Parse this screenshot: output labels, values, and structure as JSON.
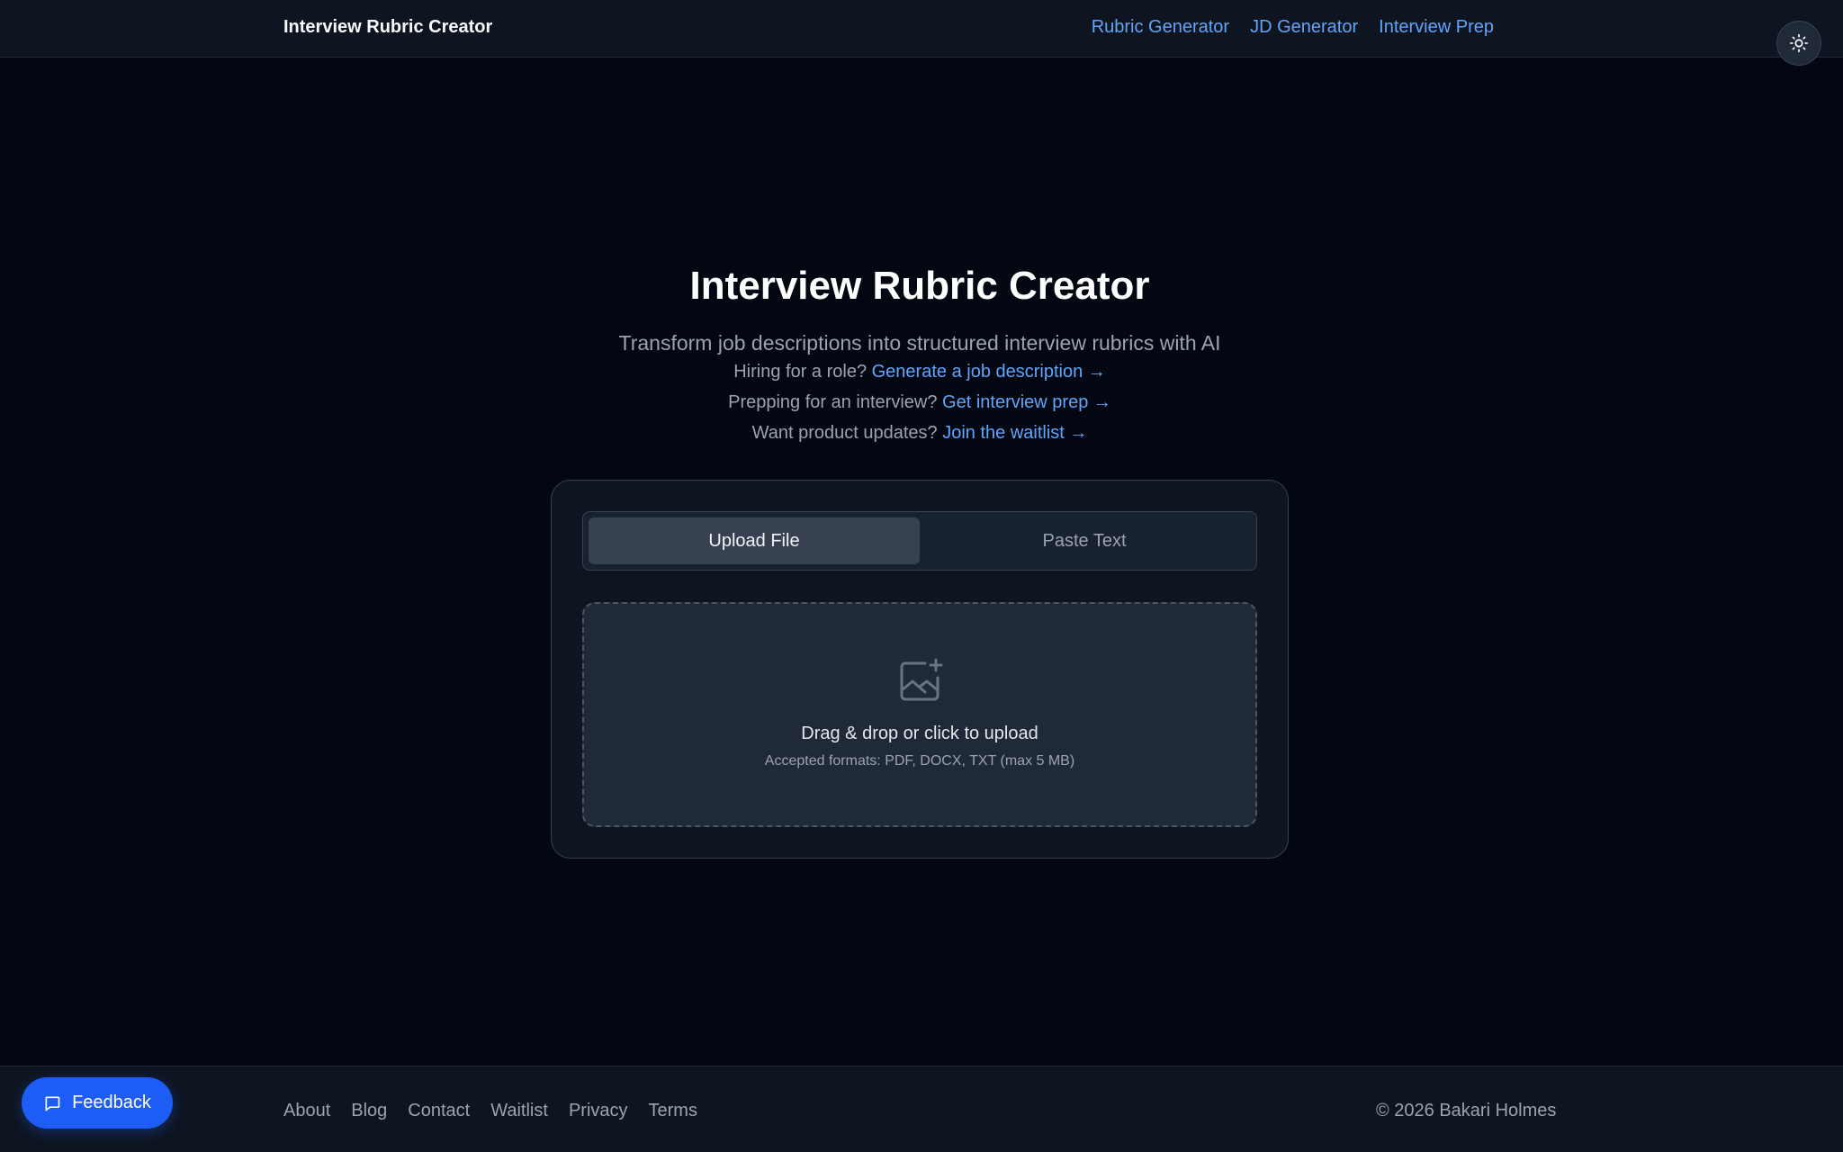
{
  "header": {
    "brand": "Interview Rubric Creator",
    "nav": [
      "Rubric Generator",
      "JD Generator",
      "Interview Prep"
    ],
    "theme_icon": "sun-icon"
  },
  "hero": {
    "title": "Interview Rubric Creator",
    "subtitle": "Transform job descriptions into structured interview rubrics with AI",
    "ctas": [
      {
        "text": "Hiring for a role?",
        "link": "Generate a job description →"
      },
      {
        "text": "Prepping for an interview?",
        "link": "Get interview prep →"
      },
      {
        "text": "Want product updates?",
        "link": "Join the waitlist →"
      }
    ]
  },
  "upload": {
    "tabs": {
      "active": "Upload File",
      "inactive": "Paste Text"
    },
    "icon": "image-plus-icon",
    "title": "Drag & drop or click to upload",
    "subtitle": "Accepted formats: PDF, DOCX, TXT (max 5 MB)"
  },
  "footer": {
    "links": [
      "About",
      "Blog",
      "Contact",
      "Waitlist",
      "Privacy",
      "Terms"
    ],
    "copyright": "© 2026 Bakari Holmes"
  },
  "feedback": {
    "label": "Feedback",
    "icon": "message-square-icon"
  },
  "colors": {
    "background": "#030712",
    "accent_link": "#60a5fa",
    "feedback_button": "#1d5cf5"
  }
}
